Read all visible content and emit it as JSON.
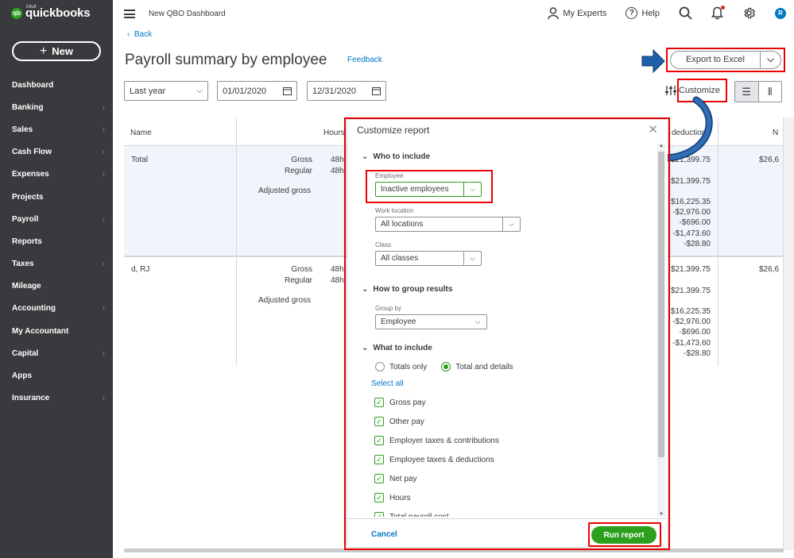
{
  "sidebar": {
    "logo_sub": "intuit",
    "logo_text": "quickbooks",
    "new_label": "New",
    "items": [
      {
        "label": "Dashboard",
        "chevron": false
      },
      {
        "label": "Banking",
        "chevron": true
      },
      {
        "label": "Sales",
        "chevron": true
      },
      {
        "label": "Cash Flow",
        "chevron": true
      },
      {
        "label": "Expenses",
        "chevron": true
      },
      {
        "label": "Projects",
        "chevron": false
      },
      {
        "label": "Payroll",
        "chevron": true
      },
      {
        "label": "Reports",
        "chevron": false
      },
      {
        "label": "Taxes",
        "chevron": true
      },
      {
        "label": "Mileage",
        "chevron": false
      },
      {
        "label": "Accounting",
        "chevron": true
      },
      {
        "label": "My Accountant",
        "chevron": false
      },
      {
        "label": "Capital",
        "chevron": true
      },
      {
        "label": "Apps",
        "chevron": false
      },
      {
        "label": "Insurance",
        "chevron": true
      }
    ]
  },
  "topbar": {
    "company": "New QBO Dashboard",
    "my_experts": "My Experts",
    "help": "Help",
    "avatar_letter": "R"
  },
  "page": {
    "back": "Back",
    "title": "Payroll summary by employee",
    "feedback": "Feedback",
    "export_label": "Export to Excel",
    "period": "Last year",
    "date_from": "01/01/2020",
    "date_to": "12/31/2020",
    "customize": "Customize"
  },
  "report": {
    "col_name": "Name",
    "col_hours": "Hours",
    "col_deduction": "deduction",
    "col_n": "N",
    "rows": [
      {
        "name": "Total",
        "gross": "Gross",
        "regular": "Regular",
        "adj": "Adjusted gross",
        "hours_g": "48h",
        "hours_r": "48h",
        "ded": [
          "$21,399.75",
          "$21,399.75",
          "$16,225.35",
          "-$2,976.00",
          "-$696.00",
          "-$1,473.60",
          "-$28.80"
        ],
        "net": "$26,6"
      },
      {
        "name": "d, RJ",
        "gross": "Gross",
        "regular": "Regular",
        "adj": "Adjusted gross",
        "hours_g": "48h",
        "hours_r": "48h",
        "ded": [
          "$21,399.75",
          "$21,399.75",
          "$16,225.35",
          "-$2,976.00",
          "-$696.00",
          "-$1,473.60",
          "-$28.80"
        ],
        "net": "$26,6"
      }
    ]
  },
  "modal": {
    "title": "Customize report",
    "who_to_include": "Who to include",
    "employee_label": "Employee",
    "employee_value": "Inactive employees",
    "work_location_label": "Work location",
    "work_location_value": "All locations",
    "class_label": "Class",
    "class_value": "All classes",
    "how_to_group": "How to group results",
    "group_by_label": "Group by",
    "group_by_value": "Employee",
    "what_to_include": "What to include",
    "totals_only": "Totals only",
    "total_and_details": "Total and details",
    "select_all": "Select all",
    "checkboxes": [
      "Gross pay",
      "Other pay",
      "Employer taxes & contributions",
      "Employee taxes & deductions",
      "Net pay",
      "Hours",
      "Total payroll cost"
    ],
    "cancel": "Cancel",
    "run_report": "Run report"
  },
  "colors": {
    "sidebar": "#393a3d",
    "brand_green": "#2ca01c",
    "link_blue": "#0077c5",
    "annotation_red": "#ee0000"
  }
}
